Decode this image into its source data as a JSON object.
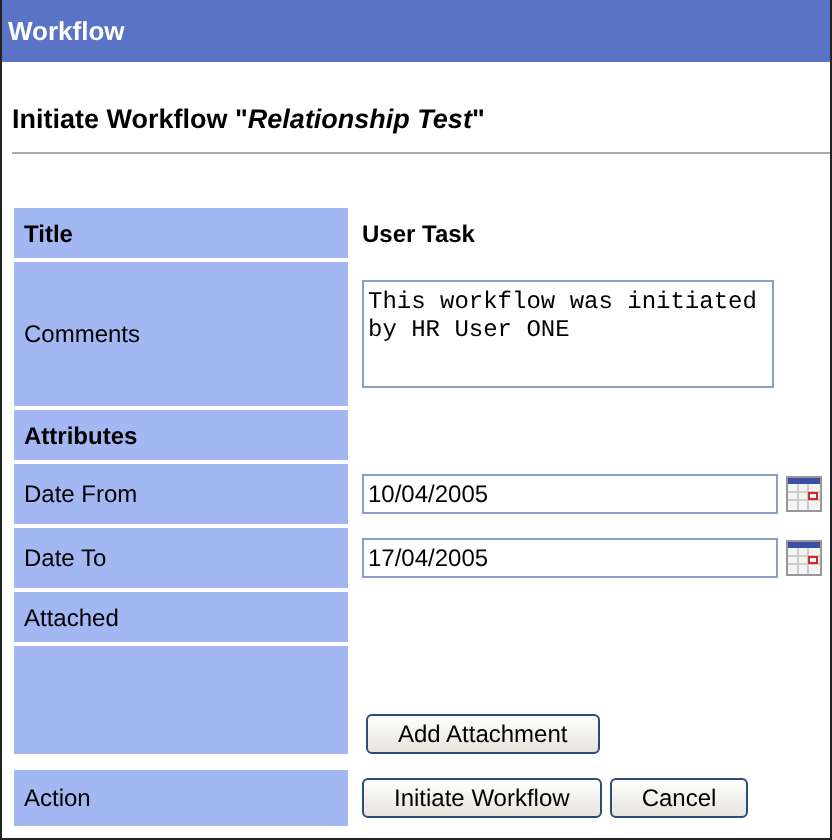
{
  "window": {
    "title": "Workflow"
  },
  "heading": "Initiate Workflow \"*Relationship Test*\"",
  "rows": [
    {
      "kind": "text",
      "label": "Title",
      "value": "User Task"
    },
    {
      "kind": "textarea",
      "label": "Comments",
      "value": "This workflow was initiated by HR User ONE"
    },
    {
      "kind": "section",
      "label": "Attributes"
    },
    {
      "kind": "date",
      "label": "Date From",
      "value": "10/04/2005"
    },
    {
      "kind": "date",
      "label": "Date To",
      "value": "17/04/2005"
    },
    {
      "kind": "label",
      "label": "Attached"
    },
    {
      "kind": "buttons",
      "buttons": [
        "Add Attachment"
      ]
    },
    {
      "kind": "buttons",
      "label": "Action",
      "buttons": [
        "Initiate Workflow",
        "Cancel"
      ]
    }
  ]
}
